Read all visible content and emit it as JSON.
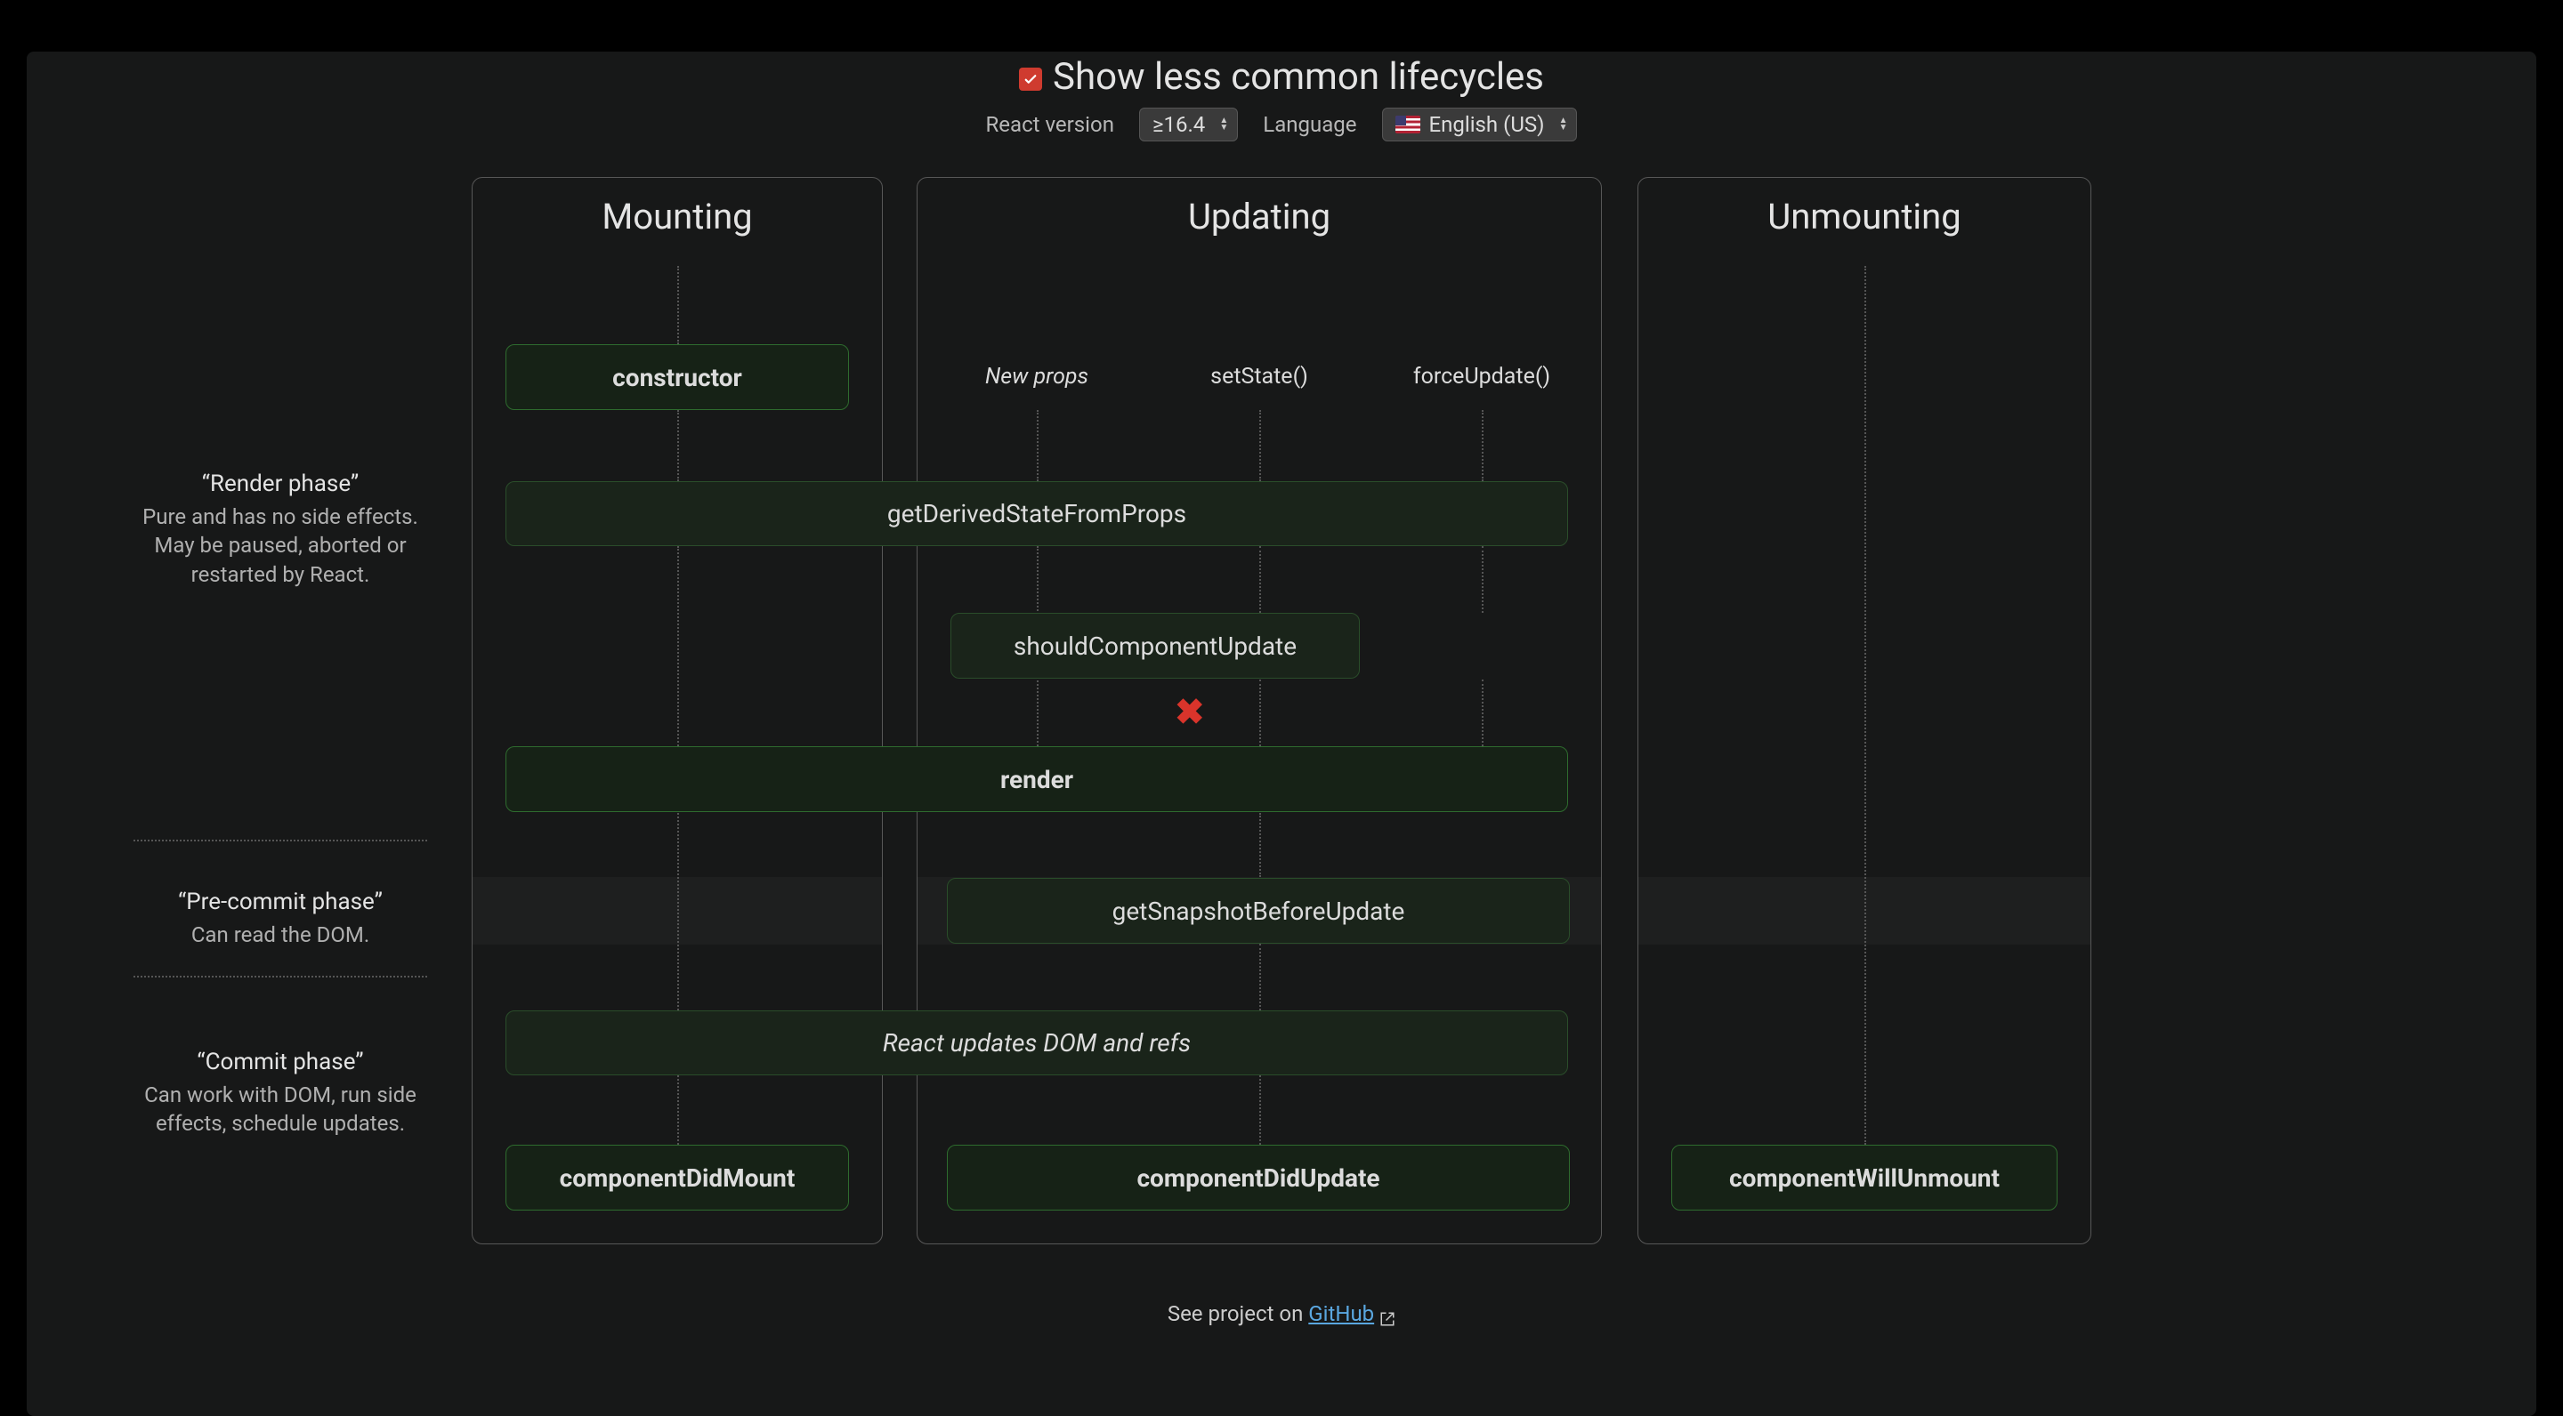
{
  "header": {
    "toggle_label": "Show less common lifecycles",
    "react_version_label": "React version",
    "react_version_value": "≥16.4",
    "language_label": "Language",
    "language_value": "English (US)"
  },
  "columns": {
    "mounting": "Mounting",
    "updating": "Updating",
    "unmounting": "Unmounting"
  },
  "phases": {
    "render": {
      "title": "“Render phase”",
      "desc": "Pure and has no side effects. May be paused, aborted or restarted by React."
    },
    "precommit": {
      "title": "“Pre-commit phase”",
      "desc": "Can read the DOM."
    },
    "commit": {
      "title": "“Commit phase”",
      "desc": "Can work with DOM, run side effects, schedule updates."
    }
  },
  "triggers": {
    "new_props": "New props",
    "set_state": "setState()",
    "force_update": "forceUpdate()"
  },
  "boxes": {
    "constructor": "constructor",
    "gdsfp": "getDerivedStateFromProps",
    "scu": "shouldComponentUpdate",
    "render": "render",
    "gsbu": "getSnapshotBeforeUpdate",
    "react_updates": "React updates DOM and refs",
    "cdm": "componentDidMount",
    "cdu": "componentDidUpdate",
    "cwu": "componentWillUnmount"
  },
  "footer": {
    "prefix": "See project on ",
    "link": "GitHub"
  }
}
